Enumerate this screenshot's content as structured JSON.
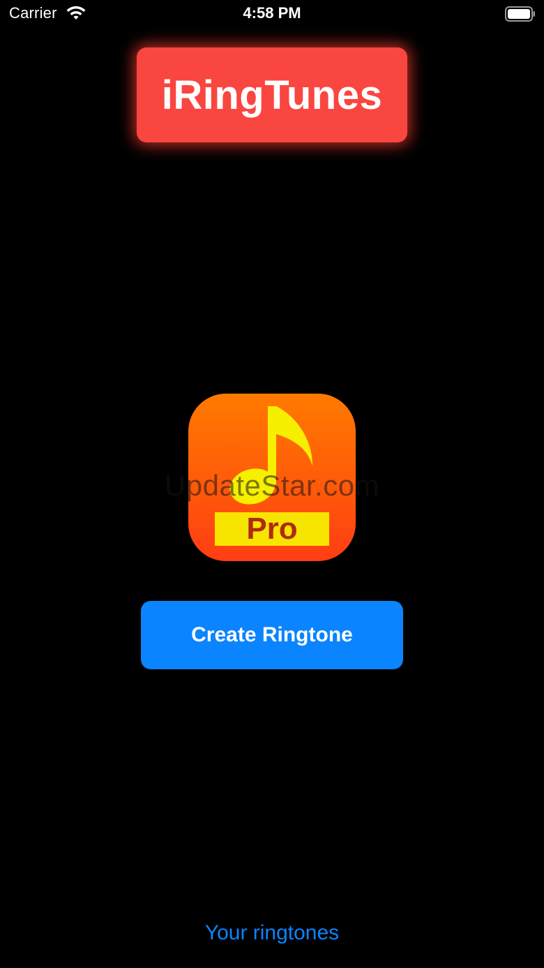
{
  "status_bar": {
    "carrier": "Carrier",
    "time": "4:58 PM",
    "wifi_icon": "wifi-icon",
    "battery_icon": "battery-full-icon"
  },
  "header": {
    "title": "iRingTunes",
    "badge_color": "#fa4640"
  },
  "app_icon": {
    "icon": "music-note-icon",
    "plate_label": "Pro",
    "gradient_top": "#ff7a00",
    "gradient_bottom": "#ff3d14",
    "note_color": "#f7ef00",
    "plate_color": "#f7e500",
    "plate_text_color": "#b02a12"
  },
  "watermark": "UpdateStar.com",
  "actions": {
    "create_label": "Create Ringtone",
    "create_color": "#0a84ff",
    "ringtones_link": "Your ringtones",
    "link_color": "#0a84ff"
  }
}
